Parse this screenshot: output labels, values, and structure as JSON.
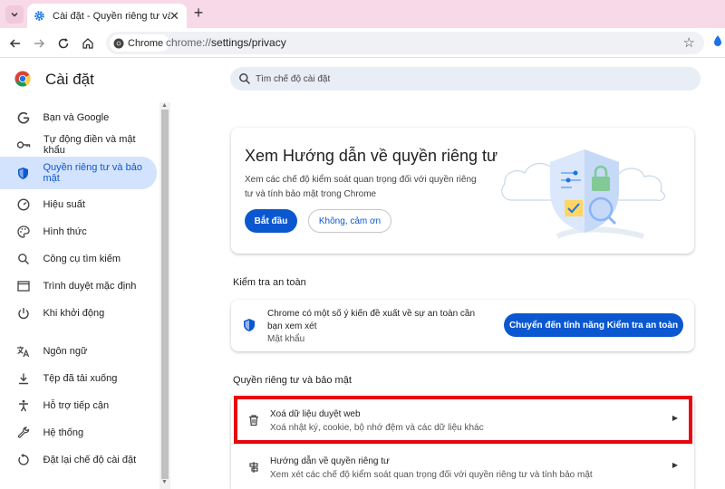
{
  "browser": {
    "tab_title": "Cài đặt - Quyền riêng tư và bảo mật",
    "omnibox_chip": "Chrome",
    "url_host": "chrome://",
    "url_path": "settings/privacy"
  },
  "settings": {
    "title": "Cài đặt",
    "search_placeholder": "Tìm chế độ cài đặt"
  },
  "sidebar": {
    "items": [
      {
        "label": "Bạn và Google",
        "icon": "google-icon"
      },
      {
        "label": "Tự động điền và mật khẩu",
        "icon": "key-icon"
      },
      {
        "label": "Quyền riêng tư và bảo mật",
        "icon": "shield-icon",
        "active": true
      },
      {
        "label": "Hiệu suất",
        "icon": "speedometer-icon"
      },
      {
        "label": "Hình thức",
        "icon": "palette-icon"
      },
      {
        "label": "Công cụ tìm kiếm",
        "icon": "search-icon"
      },
      {
        "label": "Trình duyệt mặc định",
        "icon": "browser-window-icon"
      },
      {
        "label": "Khi khởi động",
        "icon": "power-icon"
      },
      {
        "label": "Ngôn ngữ",
        "icon": "translate-icon"
      },
      {
        "label": "Tệp đã tải xuống",
        "icon": "download-icon"
      },
      {
        "label": "Hỗ trợ tiếp cận",
        "icon": "accessibility-icon"
      },
      {
        "label": "Hệ thống",
        "icon": "wrench-icon"
      },
      {
        "label": "Đặt lại chế độ cài đặt",
        "icon": "reset-icon"
      }
    ]
  },
  "guide": {
    "title": "Xem Hướng dẫn về quyền riêng tư",
    "description": "Xem các chế độ kiểm soát quan trọng đối với quyền riêng tư và tính bảo mật trong Chrome",
    "start_label": "Bắt đầu",
    "dismiss_label": "Không, cảm ơn"
  },
  "safety_check": {
    "heading": "Kiểm tra an toàn",
    "title": "Chrome có một số ý kiến đề xuất về sự an toàn cần bạn xem xét",
    "subtitle": "Mật khẩu",
    "button_label": "Chuyển đến tính năng Kiểm tra an toàn"
  },
  "privacy_section": {
    "heading": "Quyền riêng tư và bảo mật",
    "rows": [
      {
        "title": "Xoá dữ liệu duyệt web",
        "subtitle": "Xoá nhật ký, cookie, bộ nhớ đệm và các dữ liệu khác",
        "icon": "trash-icon"
      },
      {
        "title": "Hướng dẫn về quyền riêng tư",
        "subtitle": "Xem xét các chế độ kiểm soát quan trọng đối với quyền riêng tư và tính bảo mật",
        "icon": "privacy-guide-icon"
      }
    ]
  },
  "colors": {
    "tabstrip": "#f8d9e8",
    "accent": "#0b57d0",
    "active_nav": "#d3e3fd",
    "highlight": "#e8060e"
  }
}
